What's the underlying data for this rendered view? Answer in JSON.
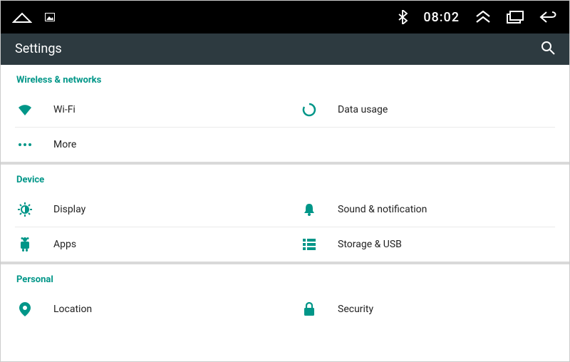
{
  "status": {
    "time": "08:02"
  },
  "header": {
    "title": "Settings"
  },
  "sections": {
    "wireless": {
      "title": "Wireless & networks",
      "wifi": "Wi-Fi",
      "data_usage": "Data usage",
      "more": "More"
    },
    "device": {
      "title": "Device",
      "display": "Display",
      "sound": "Sound & notification",
      "apps": "Apps",
      "storage": "Storage & USB"
    },
    "personal": {
      "title": "Personal",
      "location": "Location",
      "security": "Security"
    }
  }
}
